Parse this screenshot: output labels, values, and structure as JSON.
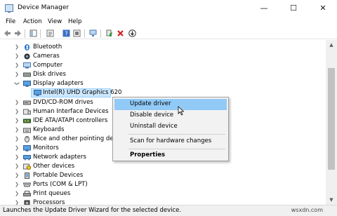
{
  "window": {
    "title": "Device Manager",
    "minimize": "—",
    "maximize": "☐",
    "close": "✕"
  },
  "menu": [
    "File",
    "Action",
    "View",
    "Help"
  ],
  "tree": [
    {
      "label": "Bluetooth",
      "icon": "bluetooth-icon",
      "state": "collapsed"
    },
    {
      "label": "Cameras",
      "icon": "camera-icon",
      "state": "collapsed"
    },
    {
      "label": "Computer",
      "icon": "computer-icon",
      "state": "collapsed"
    },
    {
      "label": "Disk drives",
      "icon": "disk-drive-icon",
      "state": "collapsed"
    },
    {
      "label": "Display adapters",
      "icon": "display-adapter-icon",
      "state": "expanded"
    },
    {
      "label": "Intel(R) UHD Graphics 620",
      "icon": "display-adapter-icon",
      "state": "child",
      "selected": true
    },
    {
      "label": "DVD/CD-ROM drives",
      "icon": "dvd-drive-icon",
      "state": "collapsed"
    },
    {
      "label": "Human Interface Devices",
      "icon": "hid-icon",
      "state": "collapsed"
    },
    {
      "label": "IDE ATA/ATAPI controllers",
      "icon": "ide-controller-icon",
      "state": "collapsed"
    },
    {
      "label": "Keyboards",
      "icon": "keyboard-icon",
      "state": "collapsed"
    },
    {
      "label": "Mice and other pointing devices",
      "icon": "mouse-icon",
      "state": "collapsed"
    },
    {
      "label": "Monitors",
      "icon": "monitor-icon",
      "state": "collapsed"
    },
    {
      "label": "Network adapters",
      "icon": "network-adapter-icon",
      "state": "collapsed"
    },
    {
      "label": "Other devices",
      "icon": "other-devices-icon",
      "state": "collapsed"
    },
    {
      "label": "Portable Devices",
      "icon": "portable-device-icon",
      "state": "collapsed"
    },
    {
      "label": "Ports (COM & LPT)",
      "icon": "ports-icon",
      "state": "collapsed"
    },
    {
      "label": "Print queues",
      "icon": "printer-icon",
      "state": "collapsed"
    },
    {
      "label": "Processors",
      "icon": "processor-icon",
      "state": "collapsed"
    }
  ],
  "context_menu": {
    "update_driver": "Update driver",
    "disable_device": "Disable device",
    "uninstall_device": "Uninstall device",
    "scan_changes": "Scan for hardware changes",
    "properties": "Properties"
  },
  "status": "Launches the Update Driver Wizard for the selected device.",
  "watermark": "wsxdn.com",
  "colors": {
    "selection": "#cce8ff",
    "menu_hover": "#91c9f7",
    "menu_bg": "#f2f2f2"
  }
}
